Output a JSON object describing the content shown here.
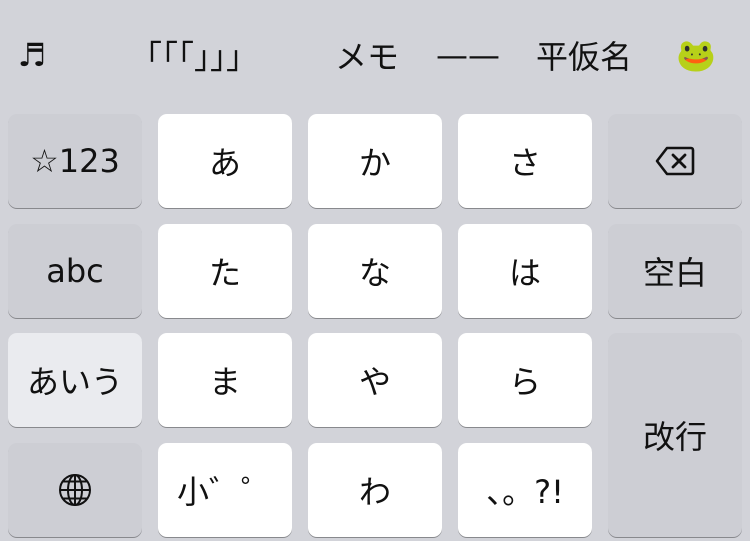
{
  "candidates": {
    "music": "♬",
    "brackets": "「「「」」」",
    "memo": "メモ",
    "dash": "——",
    "hiragana": "平仮名",
    "frog": "🐸"
  },
  "keys": {
    "num_mode": "☆123",
    "a": "あ",
    "ka": "か",
    "sa": "さ",
    "abc": "abc",
    "ta": "た",
    "na": "な",
    "ha": "は",
    "space": "空白",
    "kana_mode": "あいう",
    "ma": "ま",
    "ya": "や",
    "ra": "ら",
    "enter": "改行",
    "small_dakuten": "小゛゜",
    "wa": "わ",
    "punct": "、。?!"
  },
  "icons": {
    "delete": "delete-backspace-icon",
    "globe": "globe-icon"
  },
  "colors": {
    "keyboard_bg": "#d2d3d9",
    "letter_key": "#ffffff",
    "function_key": "#d2d3d9",
    "active_mode_key": "#eaebef"
  }
}
